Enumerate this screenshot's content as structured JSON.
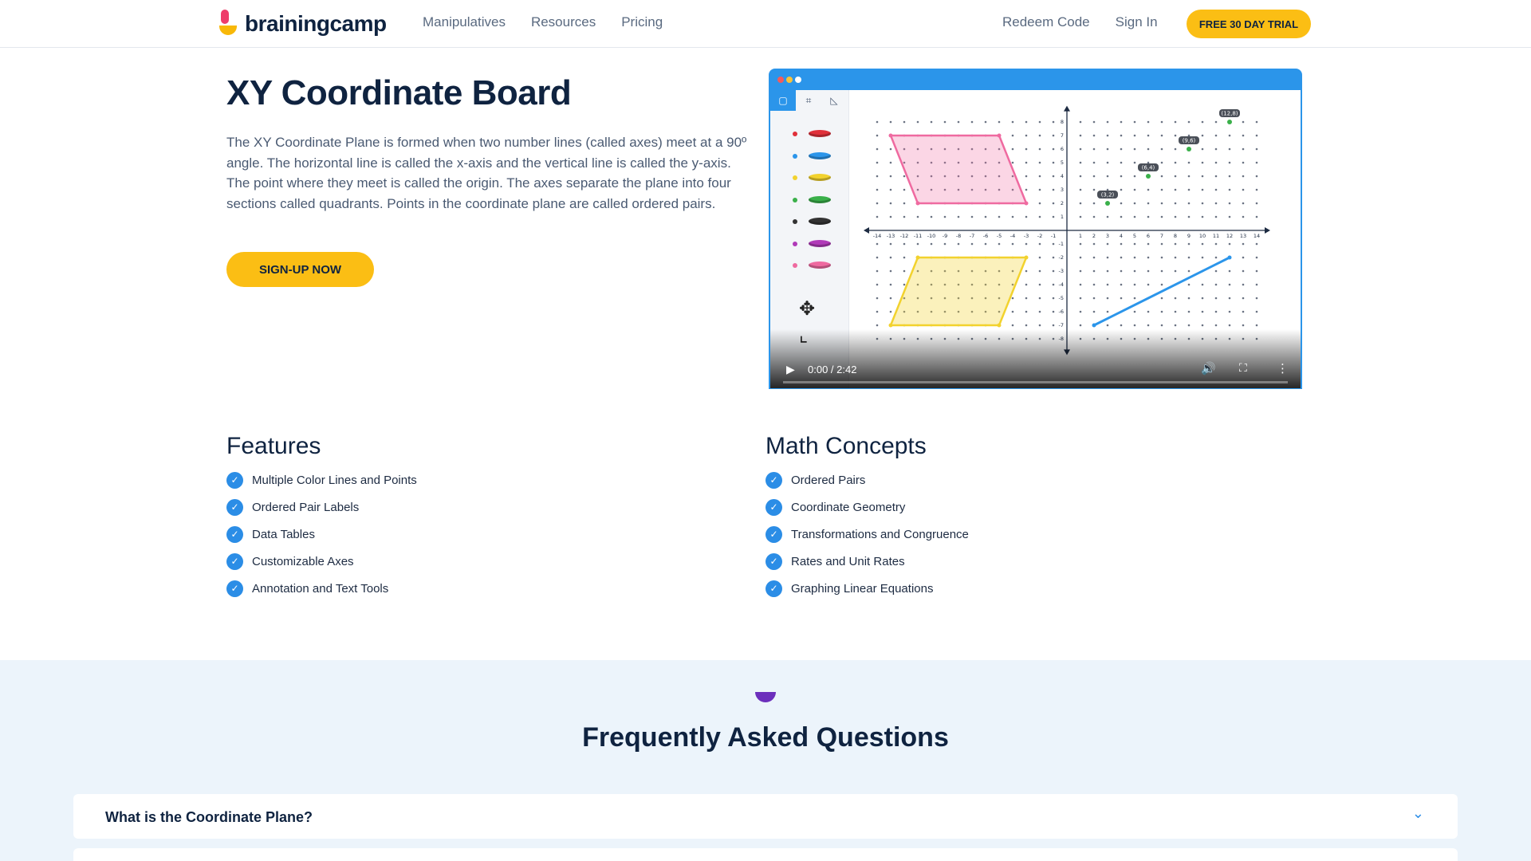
{
  "header": {
    "logo_text": "brainingcamp",
    "nav": [
      "Manipulatives",
      "Resources",
      "Pricing"
    ],
    "redeem": "Redeem Code",
    "sign_in": "Sign In",
    "trial_button": "FREE 30 DAY TRIAL"
  },
  "hero": {
    "title": "XY Coordinate Board",
    "description": "The XY Coordinate Plane is formed when two number lines (called axes) meet at a 90º angle. The horizontal line is called the x-axis and the vertical line is called the y-axis. The point where they meet is called the origin. The axes separate the plane into four sections called quadrants. Points in the coordinate plane are called ordered pairs.",
    "signup_button": "SIGN-UP NOW"
  },
  "video": {
    "time": "0:00 / 2:42",
    "progress": 0.0,
    "point_labels": [
      "(3,2)",
      "(6,4)",
      "(9,6)",
      "(12,8)"
    ],
    "x_ticks": [
      "-14",
      "-13",
      "-12",
      "-11",
      "-10",
      "-9",
      "-8",
      "-7",
      "-6",
      "-5",
      "-4",
      "-3",
      "-2",
      "-1",
      "1",
      "2",
      "3",
      "4",
      "5",
      "6",
      "7",
      "8",
      "9",
      "10",
      "11",
      "12",
      "13",
      "14"
    ],
    "y_ticks": [
      "8",
      "7",
      "6",
      "5",
      "4",
      "3",
      "2",
      "1",
      "-1",
      "-2",
      "-3",
      "-4",
      "-5",
      "-6",
      "-7",
      "-8"
    ],
    "swatch_colors": [
      "#e0303a",
      "#2b95ea",
      "#f2d22e",
      "#3ab04a",
      "#333333",
      "#b03ab8",
      "#ef6aa0"
    ]
  },
  "features": {
    "title": "Features",
    "items": [
      "Multiple Color Lines and Points",
      "Ordered Pair Labels",
      "Data Tables",
      "Customizable Axes",
      "Annotation and Text Tools"
    ]
  },
  "concepts": {
    "title": "Math Concepts",
    "items": [
      "Ordered Pairs",
      "Coordinate Geometry",
      "Transformations and Congruence",
      "Rates and Unit Rates",
      "Graphing Linear Equations"
    ]
  },
  "faq": {
    "title": "Frequently Asked Questions",
    "items": [
      "What is the Coordinate Plane?"
    ]
  }
}
